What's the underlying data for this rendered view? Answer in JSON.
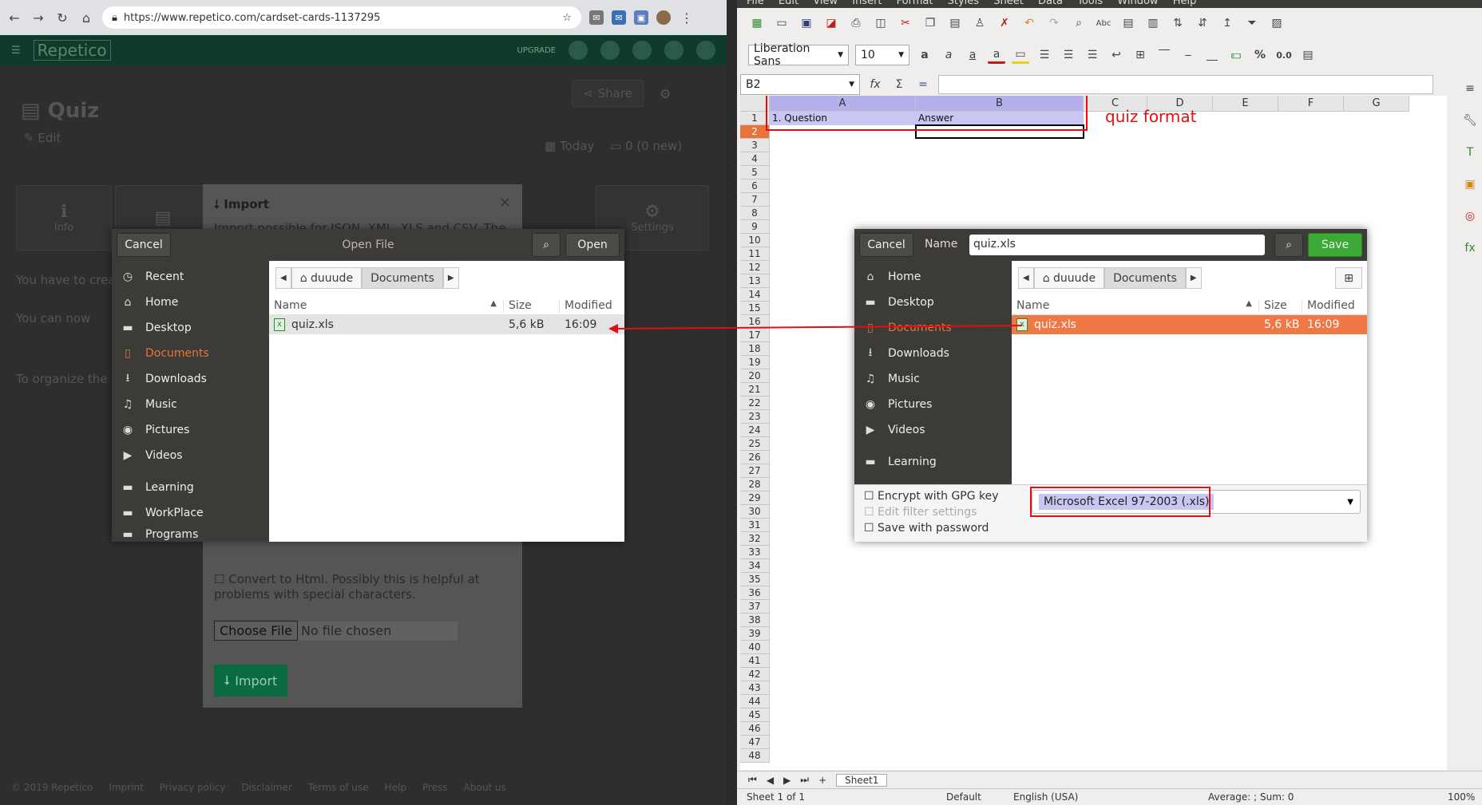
{
  "browser": {
    "url": "https://www.repetico.com/cardset-cards-1137295",
    "app_logo": "Repetico",
    "upgrade": "UPGRADE",
    "page_title": "Quiz",
    "edit": "Edit",
    "share": "Share",
    "today": "Today",
    "count": "0 (0 new)",
    "tab_info": "Info",
    "tab_settings": "Settings",
    "text_create": "You have to crea",
    "text_now": "You can now",
    "text_organize": "To organize the c",
    "footer": [
      "© 2019 Repetico",
      "Imprint",
      "Privacy policy",
      "Disclaimer",
      "Terms of use",
      "Help",
      "Press",
      "About us"
    ]
  },
  "import_modal": {
    "title": "Import",
    "description": "Import possible for JSON, XML, XLS and CSV. The files have to have a Repetico-specific structure. You can see this special structure for example in an",
    "convert": "Convert to Html. Possibly this is helpful at problems with special characters.",
    "choose_file": "Choose File",
    "no_file": "No file chosen",
    "import_button": "Import"
  },
  "open_dialog": {
    "cancel": "Cancel",
    "title": "Open File",
    "open": "Open",
    "places": [
      "Recent",
      "Home",
      "Desktop",
      "Documents",
      "Downloads",
      "Music",
      "Pictures",
      "Videos"
    ],
    "bookmarks": [
      "Learning",
      "WorkPlace",
      "Programs"
    ],
    "crumbs": [
      "duuude",
      "Documents"
    ],
    "columns": [
      "Name",
      "Size",
      "Modified"
    ],
    "file": {
      "name": "quiz.xls",
      "size": "5,6 kB",
      "modified": "16:09"
    }
  },
  "save_dialog": {
    "cancel": "Cancel",
    "name_label": "Name",
    "filename": "quiz.xls",
    "save": "Save",
    "places": [
      "Home",
      "Desktop",
      "Documents",
      "Downloads",
      "Music",
      "Pictures",
      "Videos"
    ],
    "bookmarks": [
      "Learning"
    ],
    "crumbs": [
      "duuude",
      "Documents"
    ],
    "columns": [
      "Name",
      "Size",
      "Modified"
    ],
    "file": {
      "name": "quiz.xls",
      "size": "5,6 kB",
      "modified": "16:09"
    },
    "encrypt": "Encrypt with GPG key",
    "edit_filter": "Edit filter settings",
    "save_password": "Save with password",
    "filetype": "Microsoft Excel 97-2003 (.xls)"
  },
  "calc": {
    "menu": [
      "File",
      "Edit",
      "View",
      "Insert",
      "Format",
      "Styles",
      "Sheet",
      "Data",
      "Tools",
      "Window",
      "Help"
    ],
    "font": "Liberation Sans",
    "size": "10",
    "cell_ref": "B2",
    "columns": [
      "A",
      "B",
      "C",
      "D",
      "E",
      "F",
      "G"
    ],
    "cell_a1": "1. Question",
    "cell_b1": "Answer",
    "annotation": "quiz format",
    "sheet_tab": "Sheet1",
    "status_sheet": "Sheet 1 of 1",
    "status_style": "Default",
    "status_lang": "English (USA)",
    "status_sum": "Average: ; Sum: 0",
    "zoom": "100%"
  },
  "colors": {
    "accent": "#f07746",
    "annotation": "#e01010",
    "import_green": "#0a6b40",
    "save_green": "#3aaa35"
  }
}
